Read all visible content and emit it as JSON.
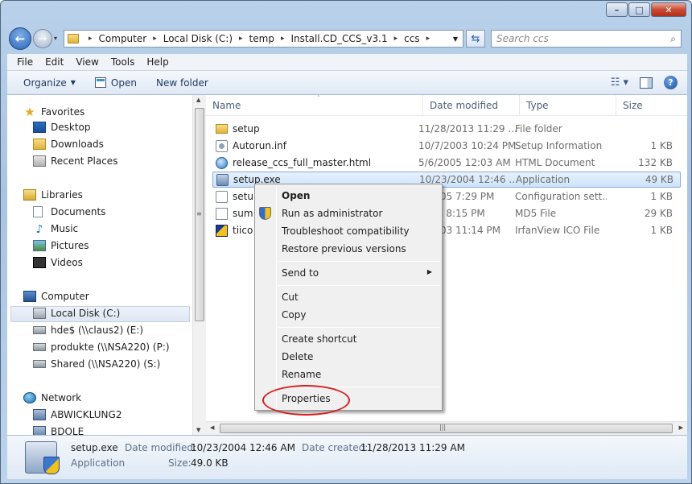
{
  "window": {
    "min_icon": "minimize-icon",
    "max_icon": "maximize-icon",
    "close_icon": "close-icon",
    "close_glyph": "✕",
    "max_glyph": "□",
    "min_glyph": "–"
  },
  "address": {
    "crumbs": [
      "Computer",
      "Local Disk (C:)",
      "temp",
      "Install.CD_CCS_v3.1",
      "ccs"
    ]
  },
  "search": {
    "placeholder": "Search ccs"
  },
  "menu": [
    "File",
    "Edit",
    "View",
    "Tools",
    "Help"
  ],
  "toolbar": {
    "organize": "Organize",
    "open": "Open",
    "new_folder": "New folder"
  },
  "nav": {
    "favorites_header": "Favorites",
    "favorites": [
      "Desktop",
      "Downloads",
      "Recent Places"
    ],
    "libraries_header": "Libraries",
    "libraries": [
      "Documents",
      "Music",
      "Pictures",
      "Videos"
    ],
    "computer_header": "Computer",
    "computer": [
      "Local Disk (C:)",
      "hde$ (\\\\claus2) (E:)",
      "produkte (\\\\NSA220) (P:)",
      "Shared (\\\\NSA220) (S:)"
    ],
    "network_header": "Network",
    "network": [
      "ABWICKLUNG2",
      "BDOLE"
    ]
  },
  "columns": [
    "Name",
    "Date modified",
    "Type",
    "Size"
  ],
  "files": [
    {
      "name": "setup",
      "date": "11/28/2013 11:29 ...",
      "type": "File folder",
      "size": "",
      "icon": "folder"
    },
    {
      "name": "Autorun.inf",
      "date": "10/7/2003 10:24 PM",
      "type": "Setup Information",
      "size": "1 KB",
      "icon": "inf"
    },
    {
      "name": "release_ccs_full_master.html",
      "date": "5/6/2005 12:03 AM",
      "type": "HTML Document",
      "size": "132 KB",
      "icon": "html"
    },
    {
      "name": "setup.exe",
      "date": "10/23/2004 12:46 ...",
      "type": "Application",
      "size": "49 KB",
      "icon": "exe",
      "selected": true
    },
    {
      "name": "setu",
      "date": "4/2005 7:29 PM",
      "type": "Configuration sett...",
      "size": "1 KB",
      "icon": "cfg"
    },
    {
      "name": "sum",
      "date": "2005 8:15 PM",
      "type": "MD5 File",
      "size": "29 KB",
      "icon": "md5"
    },
    {
      "name": "tiico",
      "date": "7/2003 11:14 PM",
      "type": "IrfanView ICO File",
      "size": "1 KB",
      "icon": "ico"
    }
  ],
  "context_menu": {
    "items": [
      "Open",
      "Run as administrator",
      "Troubleshoot compatibility",
      "Restore previous versions",
      "Send to",
      "Cut",
      "Copy",
      "Create shortcut",
      "Delete",
      "Rename",
      "Properties"
    ]
  },
  "details": {
    "filename": "setup.exe",
    "kind": "Application",
    "modified_label": "Date modified:",
    "modified": "10/23/2004 12:46 AM",
    "created_label": "Date created:",
    "created": "11/28/2013 11:29 AM",
    "size_label": "Size:",
    "size": "49.0 KB"
  }
}
